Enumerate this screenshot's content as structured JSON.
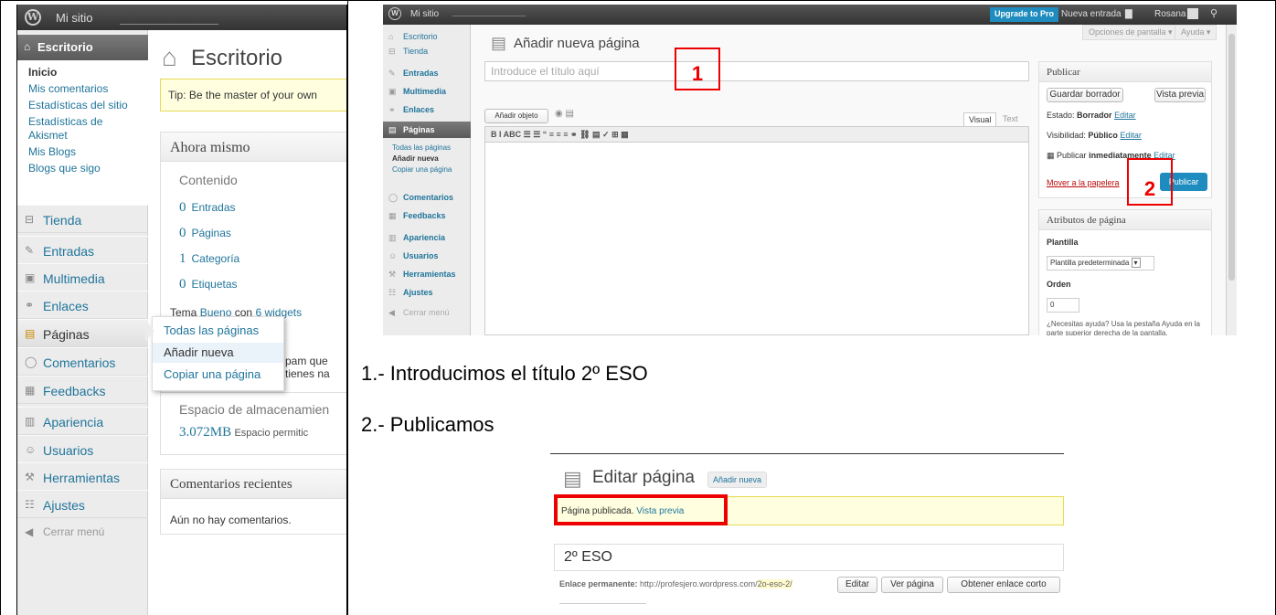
{
  "left_panel": {
    "admin_bar": {
      "site": "Mi sitio"
    },
    "menu_head": "Escritorio",
    "submenu": [
      "Inicio",
      "Mis comentarios",
      "Estadísticas del sitio",
      "Estadísticas de",
      "Akismet",
      "Mis Blogs",
      "Blogs que sigo"
    ],
    "menu": [
      "Tienda",
      "Entradas",
      "Multimedia",
      "Enlaces",
      "Páginas",
      "Comentarios",
      "Feedbacks",
      "Apariencia",
      "Usuarios",
      "Herramientas",
      "Ajustes",
      "Cerrar menú"
    ],
    "flyout": [
      "Todas las páginas",
      "Añadir nueva",
      "Copiar una página"
    ],
    "page_title": "Escritorio",
    "tip": "Tip: Be the master of your own",
    "now_box": {
      "title": "Ahora mismo",
      "content_label": "Contenido",
      "rows": [
        {
          "n": "0",
          "label": "Entradas"
        },
        {
          "n": "0",
          "label": "Páginas"
        },
        {
          "n": "1",
          "label": "Categoría"
        },
        {
          "n": "0",
          "label": "Etiquetas"
        }
      ],
      "theme_pre": "Tema",
      "theme_name": "Bueno",
      "theme_mid": "con",
      "theme_widgets": "6 widgets",
      "spam1": "pam que",
      "spam2": "tienes na",
      "storage_label": "Espacio de almacenamien",
      "storage_value": "3.072MB",
      "storage_text": "Espacio permitic"
    },
    "comments_box": {
      "title": "Comentarios recientes",
      "text": "Aún no hay comentarios."
    }
  },
  "right_shot": {
    "admin_bar": {
      "site": "Mi sitio",
      "upgrade": "Upgrade to Pro",
      "new": "Nueva entrada",
      "user": "Rosana"
    },
    "screen_options": "Opciones de pantalla ▾",
    "help": "Ayuda ▾",
    "menu": [
      "Escritorio",
      "Tienda",
      "Entradas",
      "Multimedia",
      "Enlaces",
      "Páginas",
      "Comentarios",
      "Feedbacks",
      "Apariencia",
      "Usuarios",
      "Herramientas",
      "Ajustes",
      "Cerrar menú"
    ],
    "submenu": [
      "Todas las páginas",
      "Añadir nueva",
      "Copiar una página"
    ],
    "title": "Añadir nueva página",
    "title_placeholder": "Introduce el título aquí",
    "add_media": "Añadir objeto",
    "tab_visual": "Visual",
    "tab_text": "Text",
    "toolbar": "B   I   ABC   ☰   ☰   “   ≡   ≡   ≡   ⚭   ⛓   ▤   ✓   ⊞   ▦",
    "publish_box": {
      "title": "Publicar",
      "save_draft": "Guardar borrador",
      "preview": "Vista previa",
      "status_label": "Estado:",
      "status_value": "Borrador",
      "visibility_label": "Visibilidad:",
      "visibility_value": "Público",
      "publish_label": "Publicar",
      "publish_value": "inmediatamente",
      "edit": "Editar",
      "trash": "Mover a la papelera",
      "publish_btn": "Publicar"
    },
    "attrs_box": {
      "title": "Atributos de página",
      "template_label": "Plantilla",
      "template_value": "Plantilla predeterminada",
      "order_label": "Orden",
      "order_value": "0",
      "help": "¿Necesitas ayuda? Usa la pestaña Ayuda en la parte superior derecha de la pantalla."
    },
    "marker1": "1",
    "marker2": "2"
  },
  "steps": {
    "step1": "1.- Introducimos el título 2º ESO",
    "step2": "2.- Publicamos"
  },
  "bottom_shot": {
    "title": "Editar página",
    "add_new": "Añadir nueva",
    "notice": "Página publicada.",
    "notice_link": "Vista previa",
    "page_title": "2º ESO",
    "permalink_label": "Enlace permanente:",
    "permalink_url": "http://profesjero.wordpress.com/",
    "permalink_slug": "2o-eso-2/",
    "edit": "Editar",
    "view": "Ver página",
    "shortlink": "Obtener enlace corto"
  }
}
